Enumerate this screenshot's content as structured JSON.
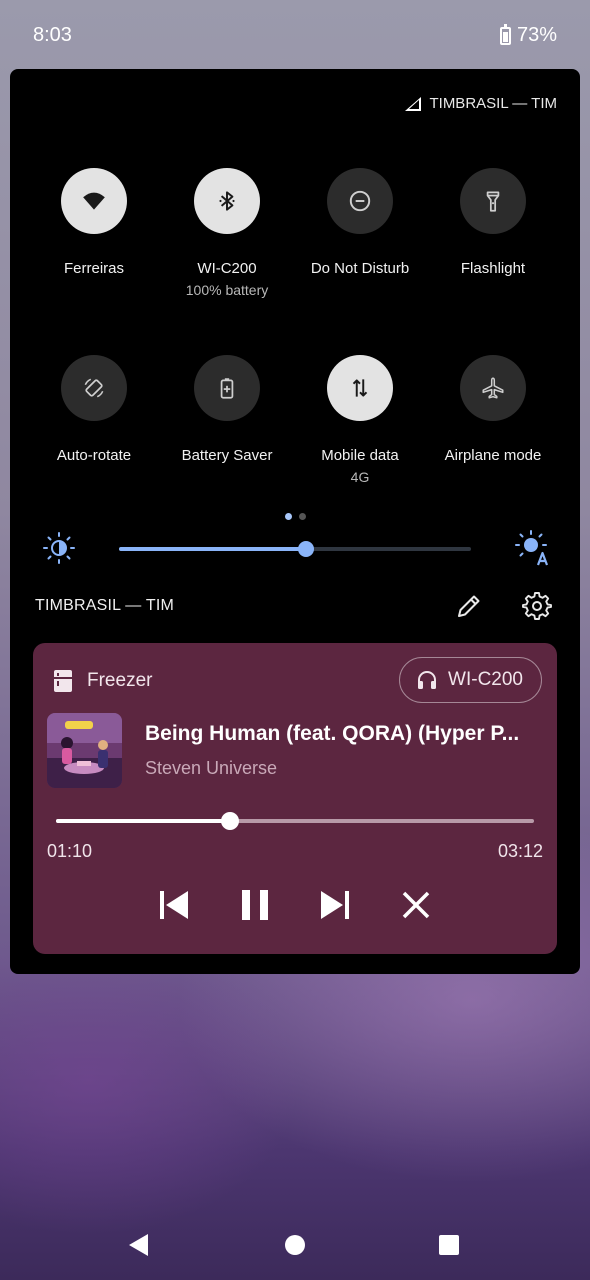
{
  "status_bar": {
    "time": "8:03",
    "battery": "73%"
  },
  "quick_settings": {
    "carrier_header": "TIMBRASIL — TIM",
    "tiles": [
      {
        "label": "Ferreiras",
        "sub": "",
        "on": true,
        "icon": "wifi-icon"
      },
      {
        "label": "WI-C200",
        "sub": "100% battery",
        "on": true,
        "icon": "bluetooth-icon"
      },
      {
        "label": "Do Not Disturb",
        "sub": "",
        "on": false,
        "icon": "dnd-icon"
      },
      {
        "label": "Flashlight",
        "sub": "",
        "on": false,
        "icon": "flashlight-icon"
      },
      {
        "label": "Auto-rotate",
        "sub": "",
        "on": false,
        "icon": "rotate-icon"
      },
      {
        "label": "Battery Saver",
        "sub": "",
        "on": false,
        "icon": "battery-saver-icon"
      },
      {
        "label": "Mobile data",
        "sub": "4G",
        "on": true,
        "icon": "mobile-data-icon"
      },
      {
        "label": "Airplane mode",
        "sub": "",
        "on": false,
        "icon": "airplane-icon"
      }
    ],
    "page_count": 2,
    "active_page": 0,
    "brightness_level": 0.53,
    "carrier_footer": "TIMBRASIL — TIM"
  },
  "media": {
    "app_name": "Freezer",
    "output_device": "WI-C200",
    "title": "Being Human (feat. QORA) (Hyper P...",
    "artist": "Steven Universe",
    "elapsed": "01:10",
    "duration": "03:12",
    "progress": 0.365,
    "controls": [
      "previous-icon",
      "pause-icon",
      "next-icon",
      "close-icon"
    ]
  },
  "colors": {
    "panel_bg": "#000000",
    "tile_on": "#e3e3e3",
    "tile_off": "#2c2c2c",
    "accent": "#8ab4f8",
    "media_card": "#5c2640"
  }
}
